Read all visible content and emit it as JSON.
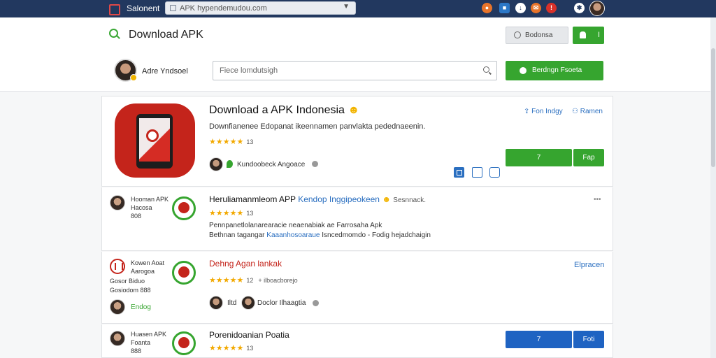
{
  "topbar": {
    "brand": "Salonent",
    "url": "APK hypendemudou.com",
    "icon_colors": [
      "#e8742a",
      "#2b77c7",
      "#ffffff",
      "#e8742a",
      "#d8312a",
      "#ffffff"
    ]
  },
  "header": {
    "title": "Download APK",
    "gray_button": "Bodonsa",
    "green_small_button": "I",
    "user_name": "Adre Yndsoel",
    "search_placeholder": "Fiece lomdutsigh",
    "green_large_button": "Berdngn Fsoeta"
  },
  "featured": {
    "title": "Download a APK Indonesia",
    "description": "Downfianenee Edopanat ikeennamen panvlakta pedednaeenin.",
    "rating_count": "13",
    "author": "Kundoobeck Angoace",
    "link_left": "Fon Indgy",
    "link_right": "Ramen",
    "btn_primary": "7",
    "btn_secondary": "Fap"
  },
  "rows": [
    {
      "side_title": "Hooman APK",
      "side_sub1": "Hacosa",
      "side_sub2": "808",
      "title": "Heruliamanmleom APP",
      "title_link": "Kendop Inggipeokeen",
      "title_tail": "Sesnnack.",
      "rating_count": "13",
      "desc1": "Pennpanetlolanarearacie neaenabiak ae Farrosaha Apk",
      "desc2a": "Bethnan tagangar",
      "desc2b": "Kaaanhosoaraue",
      "desc2c": "Isncedmomdo - Fodig hejadchaigin",
      "dots": "•••"
    },
    {
      "side_title": "Kowen Aoat",
      "side_sub1": "Aarogoa",
      "side_sub2": "Gosor Biduo",
      "side_sub3": "Gosiodom 888",
      "side_name": "Endog",
      "title": "Dehng Agan lankak",
      "rating_count": "12",
      "rating_extra": "+ ilboacborejo",
      "author1": "Iltd",
      "author2": "Doclor Ilhaagtia",
      "link": "Elpracen"
    },
    {
      "side_title": "Huasen APK",
      "side_sub1": "Foanta",
      "side_sub2": "888",
      "title": "Porenidoanian Poatia",
      "rating_count": "13",
      "btn_primary": "7",
      "btn_secondary": "Foti"
    }
  ],
  "colors": {
    "topbar": "#22385f",
    "green": "#36a52f",
    "blue": "#1f63c2",
    "star": "#f2a900"
  }
}
